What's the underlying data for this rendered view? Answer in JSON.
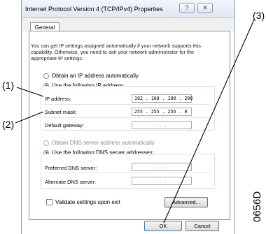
{
  "window": {
    "title": "Internet Protocol Version 4 (TCP/IPv4) Properties",
    "help_glyph": "?",
    "close_glyph": "✕"
  },
  "tabs": [
    {
      "label": "General"
    }
  ],
  "description": "You can get IP settings assigned automatically if your network supports this capability. Otherwise, you need to ask your network administrator for the appropriate IP settings.",
  "ip_settings": {
    "auto_label": "Obtain an IP address automatically",
    "manual_label": "Use the following IP address:",
    "selected": "manual",
    "fields": [
      {
        "label": "IP address:",
        "value": "192 . 168 . 100 . 200"
      },
      {
        "label": "Subnet mask:",
        "value": "255 . 255 . 255 .  0"
      },
      {
        "label": "Default gateway:",
        "value": ".      .      ."
      }
    ]
  },
  "dns_settings": {
    "auto_label": "Obtain DNS server address automatically",
    "manual_label": "Use the following DNS server addresses:",
    "selected": "manual",
    "fields": [
      {
        "label": "Preferred DNS server:",
        "value": ".      .      ."
      },
      {
        "label": "Alternate DNS server:",
        "value": ".      .      ."
      }
    ]
  },
  "validate_label": "Validate settings upon exit",
  "buttons": {
    "advanced": "Advanced...",
    "ok": "OK",
    "cancel": "Cancel"
  },
  "callouts": {
    "c1": "(1)",
    "c2": "(2)",
    "c3": "(3)"
  },
  "document_id": "0656D"
}
